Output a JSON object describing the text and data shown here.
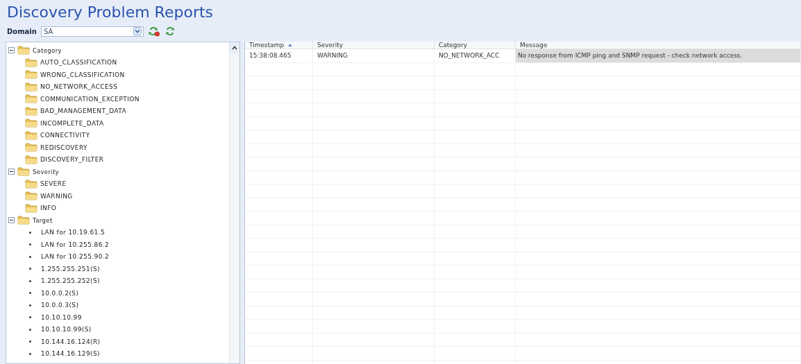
{
  "window": {
    "title": "Discovery Problem Reports"
  },
  "toolbar": {
    "domain_label": "Domain",
    "domain_value": "SA"
  },
  "tree": [
    {
      "label": "Category",
      "kind": "folder",
      "expanded": true,
      "children": [
        {
          "label": "AUTO_CLASSIFICATION",
          "kind": "folder"
        },
        {
          "label": "WRONG_CLASSIFICATION",
          "kind": "folder"
        },
        {
          "label": "NO_NETWORK_ACCESS",
          "kind": "folder"
        },
        {
          "label": "COMMUNICATION_EXCEPTION",
          "kind": "folder"
        },
        {
          "label": "BAD_MANAGEMENT_DATA",
          "kind": "folder"
        },
        {
          "label": "INCOMPLETE_DATA",
          "kind": "folder"
        },
        {
          "label": "CONNECTIVITY",
          "kind": "folder"
        },
        {
          "label": "REDISCOVERY",
          "kind": "folder"
        },
        {
          "label": "DISCOVERY_FILTER",
          "kind": "folder"
        }
      ]
    },
    {
      "label": "Severity",
      "kind": "folder",
      "expanded": true,
      "children": [
        {
          "label": "SEVERE",
          "kind": "folder"
        },
        {
          "label": "WARNING",
          "kind": "folder"
        },
        {
          "label": "INFO",
          "kind": "folder"
        }
      ]
    },
    {
      "label": "Target",
      "kind": "folder",
      "expanded": true,
      "children": [
        {
          "label": "LAN for 10.19.61.5",
          "kind": "leaf"
        },
        {
          "label": "LAN for 10.255.86.2",
          "kind": "leaf"
        },
        {
          "label": "LAN for 10.255.90.2",
          "kind": "leaf"
        },
        {
          "label": "1.255.255.251(S)",
          "kind": "leaf"
        },
        {
          "label": "1.255.255.252(S)",
          "kind": "leaf"
        },
        {
          "label": "10.0.0.2(S)",
          "kind": "leaf"
        },
        {
          "label": "10.0.0.3(S)",
          "kind": "leaf"
        },
        {
          "label": "10.10.10.99",
          "kind": "leaf"
        },
        {
          "label": "10.10.10.99(S)",
          "kind": "leaf"
        },
        {
          "label": "10.144.16.124(R)",
          "kind": "leaf"
        },
        {
          "label": "10.144.16.129(S)",
          "kind": "leaf"
        }
      ]
    }
  ],
  "table": {
    "columns": [
      {
        "label": "Timestamp",
        "sorted": true
      },
      {
        "label": "Severity",
        "sorted": false
      },
      {
        "label": "Category",
        "sorted": false
      },
      {
        "label": "Message",
        "sorted": false
      }
    ],
    "rows": [
      {
        "cells": [
          "15:38:08.465",
          "WARNING",
          "NO_NETWORK_ACC",
          "No response from ICMP ping and SNMP request - check network access."
        ],
        "selected": true
      }
    ]
  }
}
